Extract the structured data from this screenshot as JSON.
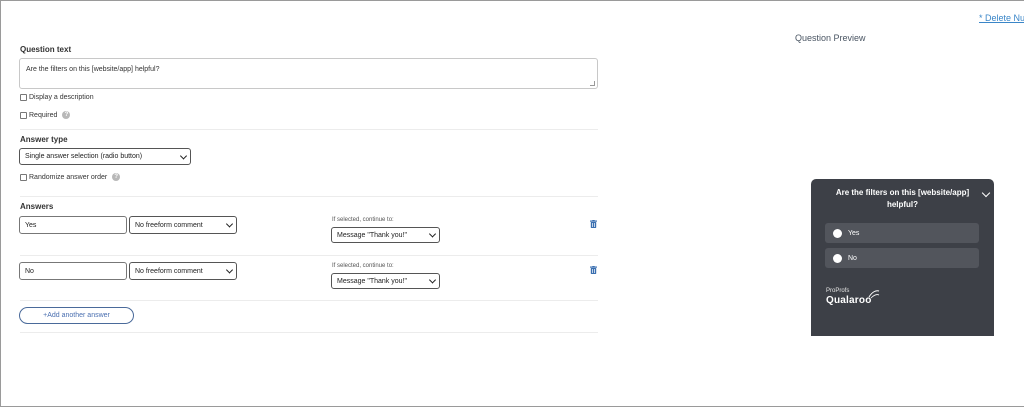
{
  "header": {
    "delete_link": "* Delete Nu",
    "preview_title": "Question Preview"
  },
  "question": {
    "label": "Question text",
    "value": "Are the filters on this [website/app] helpful?",
    "display_description": "Display a description",
    "required": "Required"
  },
  "answer_type": {
    "label": "Answer type",
    "selected": "Single answer selection (radio button)",
    "randomize": "Randomize answer order"
  },
  "answers": {
    "label": "Answers",
    "items": [
      {
        "value": "Yes",
        "comment": "No freeform comment",
        "continue_label": "If selected, continue to:",
        "continue_value": "Message \"Thank you!\""
      },
      {
        "value": "No",
        "comment": "No freeform comment",
        "continue_label": "If selected, continue to:",
        "continue_value": "Message \"Thank you!\""
      }
    ],
    "add_label": "+Add another answer"
  },
  "preview": {
    "title": "Are the filters on this [website/app] helpful?",
    "options": [
      "Yes",
      "No"
    ],
    "brand_top": "ProProfs",
    "brand": "Qualaroo",
    "colors": {
      "widget_bg": "#3d4047",
      "option_bg": "#52555c",
      "link": "#3a86c8"
    }
  }
}
